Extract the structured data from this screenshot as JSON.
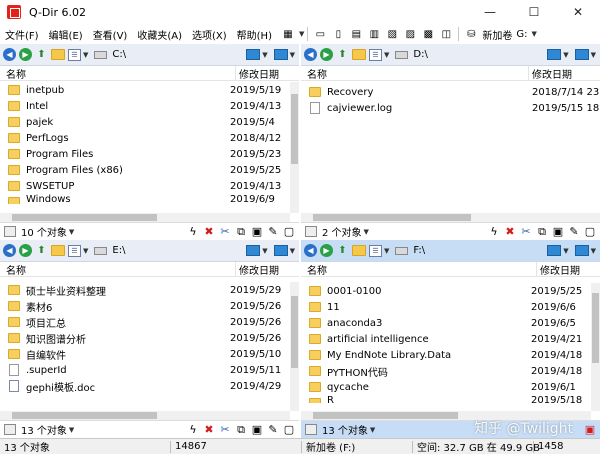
{
  "window": {
    "title": "Q-Dir 6.02",
    "brand_color": "#e2231a",
    "minimize": "—",
    "maximize": "☐",
    "close": "✕"
  },
  "menu": {
    "items": [
      "文件(F)",
      "编辑(E)",
      "查看(V)",
      "收藏夹(A)",
      "选项(X)",
      "帮助(H)"
    ],
    "drive_label": "新加卷",
    "drive_suffix": "G:"
  },
  "panes": {
    "tl": {
      "path": "C:\\",
      "header_name": "名称",
      "header_date": "修改日期",
      "rows": [
        {
          "name": "inetpub",
          "date": "2019/5/19"
        },
        {
          "name": "Intel",
          "date": "2019/4/13"
        },
        {
          "name": "pajek",
          "date": "2019/5/4"
        },
        {
          "name": "PerfLogs",
          "date": "2018/4/12"
        },
        {
          "name": "Program Files",
          "date": "2019/5/23"
        },
        {
          "name": "Program Files (x86)",
          "date": "2019/5/25"
        },
        {
          "name": "SWSETUP",
          "date": "2019/4/13"
        },
        {
          "name": "Windows",
          "date": "2019/6/9"
        }
      ],
      "count": "10 个对象"
    },
    "tr": {
      "path": "D:\\",
      "header_name": "名称",
      "header_date": "修改日期",
      "rows": [
        {
          "name": "Recovery",
          "date": "2018/7/14 23"
        },
        {
          "name": "cajviewer.log",
          "date": "2019/5/15 18"
        }
      ],
      "count": "2 个对象"
    },
    "bl": {
      "path": "E:\\",
      "header_name": "名称",
      "header_date": "修改日期",
      "rows": [
        {
          "name": "硕士毕业资料整理",
          "date": "2019/5/29"
        },
        {
          "name": "素材6",
          "date": "2019/5/26"
        },
        {
          "name": "项目汇总",
          "date": "2019/5/26"
        },
        {
          "name": "知识图谱分析",
          "date": "2019/5/26"
        },
        {
          "name": "自编软件",
          "date": "2019/5/10"
        },
        {
          "name": ".superId",
          "date": "2019/5/11"
        },
        {
          "name": "gephi模板.doc",
          "date": "2019/4/29"
        }
      ],
      "count": "13 个对象"
    },
    "br": {
      "path": "F:\\",
      "header_name": "名称",
      "header_date": "修改日期",
      "rows": [
        {
          "name": "0001-0100",
          "date": "2019/5/25"
        },
        {
          "name": "11",
          "date": "2019/6/6"
        },
        {
          "name": "anaconda3",
          "date": "2019/6/5"
        },
        {
          "name": "artificial intelligence",
          "date": "2019/4/21"
        },
        {
          "name": "My EndNote Library.Data",
          "date": "2019/4/18"
        },
        {
          "name": "PYTHON代码",
          "date": "2019/4/18"
        },
        {
          "name": "qycache",
          "date": "2019/6/1"
        },
        {
          "name": "R",
          "date": "2019/5/18"
        }
      ],
      "count": "13 个对象"
    }
  },
  "bottom": {
    "count": "13 个对象",
    "size": "14867",
    "volume": "新加卷 (F:)",
    "free": "空间: 32.7 GB 在 49.9 GB",
    "number": "1458"
  },
  "watermark": "知乎 @Twilight"
}
